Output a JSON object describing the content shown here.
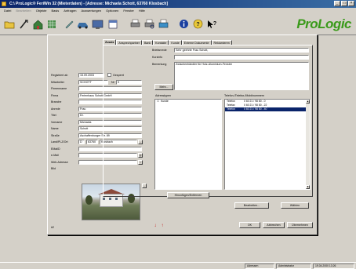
{
  "window": {
    "title": "C:\\ ProLogic® FeriWin 32 (Mieterdaten) - [Adresse: Michaela Schott, 63760 Klosbach]",
    "controls": [
      "_",
      "□",
      "×"
    ]
  },
  "menu": {
    "items": [
      {
        "label": "Datei",
        "disabled": false
      },
      {
        "label": "Bearbeiten",
        "disabled": true
      },
      {
        "label": "Objekte",
        "disabled": false
      },
      {
        "label": "Basis",
        "disabled": false
      },
      {
        "label": "Anfragen",
        "disabled": false
      },
      {
        "label": "Auswertungen",
        "disabled": false
      },
      {
        "label": "Optionen",
        "disabled": false
      },
      {
        "label": "Fenster",
        "disabled": false
      },
      {
        "label": "Hilfe",
        "disabled": false
      }
    ]
  },
  "toolbar": {
    "icons": [
      "open-folder-icon",
      "pointer-icon",
      "house-icon",
      "database-icon",
      "pen-icon",
      "car-icon",
      "monitor-icon",
      "calendar-icon",
      "printer-icon",
      "printer-preview-icon",
      "print-setup-icon",
      "info-icon",
      "help-icon",
      "whats-this-icon"
    ],
    "logo": "ProLogic"
  },
  "form": {
    "left": {
      "registered_label": "Registriert ab",
      "registered_value": "15.09.2003",
      "blocked_label": "Gesperrt",
      "mitarbeiter_label": "Mitarbeiter",
      "mitarbeiter_value": "SCHOTT",
      "nr_label": "Nr",
      "nr_value": "9",
      "firmenname_label": "Firmenname",
      "firmenname_value": "",
      "firma_label": "Firma",
      "firma_value": "Ferienhaus Schott GmbH",
      "branche_label": "Branche",
      "branche_value": "",
      "anrede_label": "Anrede",
      "anrede_value": "Frau",
      "titel_label": "Titel",
      "titel_value": "Dr.",
      "vorname_label": "Vorname",
      "vorname_value": "Michaela",
      "name_label": "Name",
      "name_value": "Schott",
      "strasse_label": "Straße",
      "strasse_value": "Aschaffenburger Str. 89",
      "land_label": "Land/PLZ/Ort",
      "land_value": "D",
      "plz_value": "63760",
      "ort_value": "Klosbach",
      "email_label": "EMailD",
      "email_value": "",
      "email2_label": "e-Mail",
      "email2_value": "",
      "web_label": "Web-Adresse",
      "web_value": "",
      "bild_label": "Bild",
      "footer_label": "#2"
    },
    "tabs": [
      {
        "label": "Zusatz",
        "active": true
      },
      {
        "label": "Ansprechpartner",
        "active": false
      },
      {
        "label": "Bank",
        "active": false
      },
      {
        "label": "Kontakte",
        "active": false
      },
      {
        "label": "Kunde",
        "active": false
      },
      {
        "label": "Externe Dokumente",
        "active": false
      },
      {
        "label": "Reklamieren",
        "active": false
      }
    ],
    "zusatz": {
      "briefanrede_label": "Briefanrede",
      "briefanrede_value": "Sehr geehrte Frau Schott,",
      "kurzinfo_label": "Kurzinfo",
      "kurzinfo_value": "",
      "bemerkung_label": "Bemerkung",
      "bemerkung_value": "Zwischenhändler für Holz-Aluminium-Fenster",
      "mehr_button": "Mehr..."
    },
    "adresstyp": {
      "header": "Adresstypen",
      "items": [
        "Kunde"
      ],
      "button": "Hinzufügen/Entfernen"
    },
    "telefon": {
      "header": "Telefon-/Telefax-/Mobilnummern",
      "rows": [
        {
          "type": "Telefon",
          "number": "0 60 21 / 98 80 - 0",
          "selected": false
        },
        {
          "type": "Telefax",
          "number": "0 60 21 / 98 80 - 22",
          "selected": false
        },
        {
          "type": "Telefon",
          "number": "0 60 21 / 98 80 - 40",
          "selected": true
        }
      ],
      "edit_button": "Bearbeiten...",
      "dial_button": "Wählen"
    },
    "footer_buttons": {
      "ok": "OK",
      "cancel": "Abbrechen",
      "save": "Übernehmen"
    }
  },
  "statusbar": {
    "cells": [
      "Adressen",
      "Administrator",
      "19.04.2000 13:26"
    ]
  }
}
